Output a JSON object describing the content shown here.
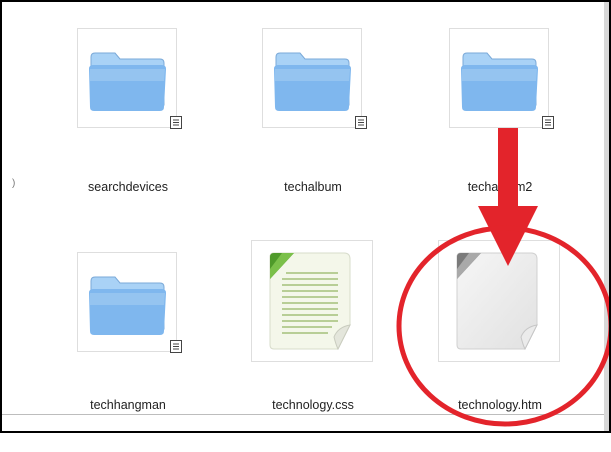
{
  "files": [
    {
      "name": "searchdevices",
      "icon": "folder-icon",
      "badge": "file-badge-icon"
    },
    {
      "name": "techalbum",
      "icon": "folder-icon",
      "badge": "file-badge-icon"
    },
    {
      "name": "techalbum2",
      "icon": "folder-icon",
      "badge": "file-badge-icon"
    },
    {
      "name": "techhangman",
      "icon": "folder-icon",
      "badge": "file-badge-icon"
    },
    {
      "name": "technology.css",
      "icon": "css-file-icon"
    },
    {
      "name": "technology.htm",
      "icon": "htm-file-icon"
    }
  ],
  "annotation": {
    "arrow": "red-arrow-icon",
    "circle": "red-highlight-circle-icon",
    "color": "#e3242b"
  },
  "colors": {
    "folder_front": "#7fb7ee",
    "folder_back": "#a9d2f6",
    "css_corner": "#4f9a2a",
    "label_text": "#222222"
  }
}
